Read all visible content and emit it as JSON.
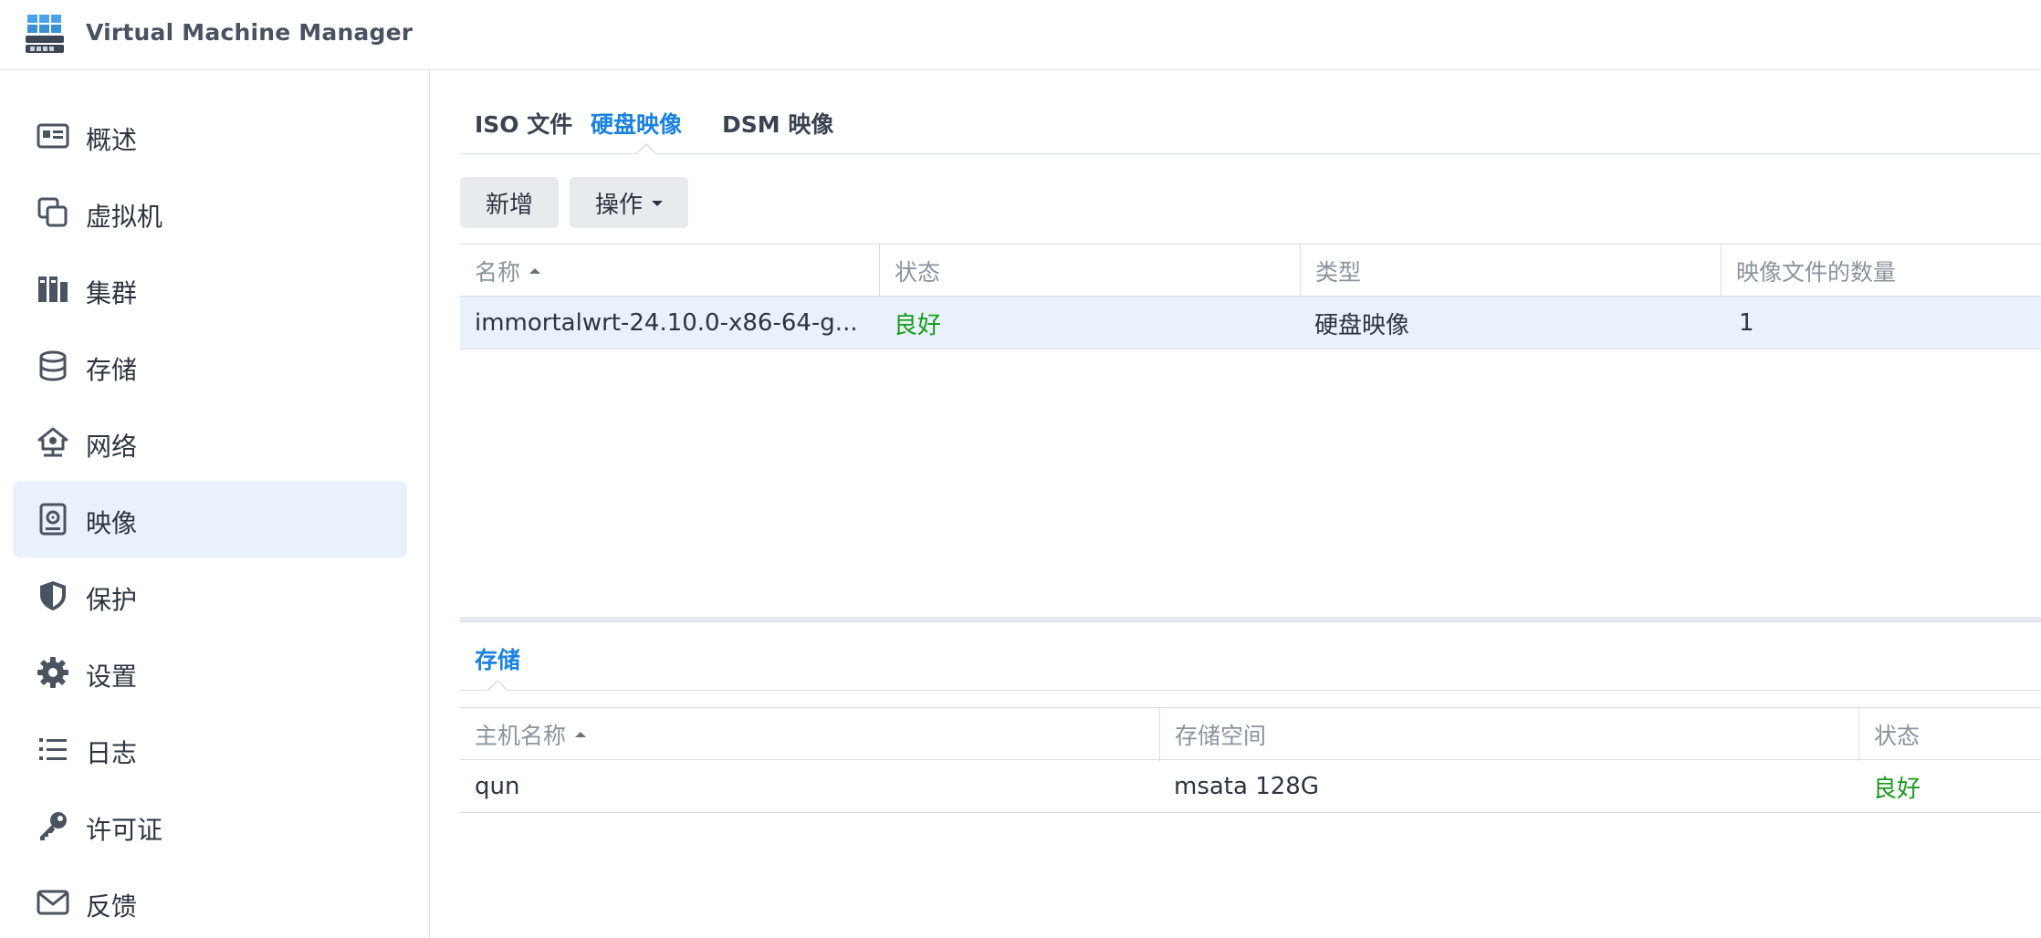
{
  "app": {
    "title": "Virtual Machine Manager",
    "logo_icon": "vmm-logo-icon",
    "accent_color": "#1c82e0",
    "ok_color": "#1a9a1a"
  },
  "sidebar": {
    "items": [
      {
        "label": "概述",
        "icon": "overview-icon",
        "active": false
      },
      {
        "label": "虚拟机",
        "icon": "virtual-machine-icon",
        "active": false
      },
      {
        "label": "集群",
        "icon": "cluster-icon",
        "active": false
      },
      {
        "label": "存储",
        "icon": "storage-icon",
        "active": false
      },
      {
        "label": "网络",
        "icon": "network-icon",
        "active": false
      },
      {
        "label": "映像",
        "icon": "image-icon",
        "active": true
      },
      {
        "label": "保护",
        "icon": "shield-icon",
        "active": false
      },
      {
        "label": "设置",
        "icon": "gear-icon",
        "active": false
      },
      {
        "label": "日志",
        "icon": "list-icon",
        "active": false
      },
      {
        "label": "许可证",
        "icon": "key-icon",
        "active": false
      },
      {
        "label": "反馈",
        "icon": "mail-icon",
        "active": false
      }
    ]
  },
  "tabs": [
    {
      "label": "ISO 文件",
      "active": false
    },
    {
      "label": "硬盘映像",
      "active": true
    },
    {
      "label": "DSM 映像",
      "active": false
    }
  ],
  "toolbar": {
    "add_label": "新增",
    "action_label": "操作"
  },
  "image_table": {
    "columns": [
      "名称",
      "状态",
      "类型",
      "映像文件的数量"
    ],
    "sorted_column": "名称",
    "rows": [
      {
        "name": "immortalwrt-24.10.0-x86-64-g...",
        "status": "良好",
        "type": "硬盘映像",
        "count": "1",
        "selected": true
      }
    ]
  },
  "detail": {
    "tab_label": "存储",
    "columns": [
      "主机名称",
      "存储空间",
      "状态"
    ],
    "sorted_column": "主机名称",
    "rows": [
      {
        "host": "qun",
        "volume": "msata 128G",
        "status": "良好"
      }
    ]
  }
}
